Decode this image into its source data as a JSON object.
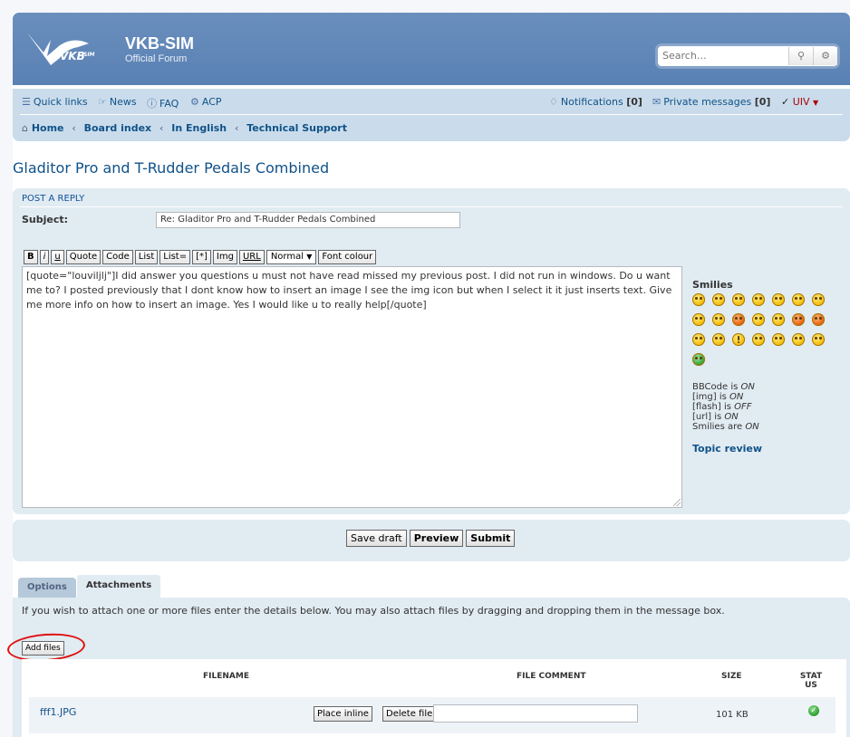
{
  "header": {
    "site_title": "VKB-SIM",
    "site_description": "Official Forum",
    "logo_text": "VKBSIM",
    "search_placeholder": "Search…",
    "search_icon": "search-icon",
    "advanced_search_icon": "gear-icon",
    "brand_color": "#5a81b4"
  },
  "navbar": {
    "quick_links": "Quick links",
    "news": "News",
    "faq": "FAQ",
    "acp": "ACP",
    "notifications_label": "Notifications",
    "notifications_count": "[0]",
    "private_messages_label": "Private messages",
    "private_messages_count": "[0]",
    "user_name": "UIV",
    "breadcrumbs": [
      "Home",
      "Board index",
      "In English",
      "Technical Support"
    ]
  },
  "topic_title": "Gladitor Pro and T-Rudder Pedals Combined",
  "post": {
    "panel_title": "POST A REPLY",
    "subject_label": "Subject:",
    "subject_value": "Re: Gladitor Pro and T-Rudder Pedals Combined",
    "format_buttons": [
      "B",
      "i",
      "u",
      "Quote",
      "Code",
      "List",
      "List=",
      "[*]",
      "Img",
      "URL"
    ],
    "font_size_select": "Normal",
    "font_colour_button": "Font colour",
    "message": "[quote=\"louviljlj\"]I did answer you questions u must not have read missed my previous post. I did not run in windows. Do u want me to? I posted previously that I dont know how to insert an image I see the img icon but when I select it it just inserts text. Give me more info on how to insert an image. Yes I would like u to really help[/quote]"
  },
  "sidebar": {
    "smilies_title": "Smilies",
    "smilies_count": 22,
    "bbcode_status": "BBCode is",
    "bbcode_value": "ON",
    "img_status": "[img] is",
    "img_value": "ON",
    "flash_status": "[flash] is",
    "flash_value": "OFF",
    "url_status": "[url] is",
    "url_value": "ON",
    "smilies_status": "Smilies are",
    "smilies_value": "ON",
    "topic_review": "Topic review"
  },
  "actions": {
    "save_draft": "Save draft",
    "preview": "Preview",
    "submit": "Submit"
  },
  "tabs": [
    {
      "label": "Options",
      "active": false
    },
    {
      "label": "Attachments",
      "active": true
    }
  ],
  "attachments": {
    "instructions": "If you wish to attach one or more files enter the details below. You may also attach files by dragging and dropping them in the message box.",
    "add_files": "Add files",
    "columns": [
      "FILENAME",
      "FILE COMMENT",
      "SIZE",
      "STAT",
      "US"
    ],
    "rows": [
      {
        "filename": "fff1.JPG",
        "place_inline": "Place inline",
        "delete_file": "Delete file",
        "comment": "",
        "size": "101 KB",
        "status_icon": "check-circle-icon"
      }
    ]
  }
}
